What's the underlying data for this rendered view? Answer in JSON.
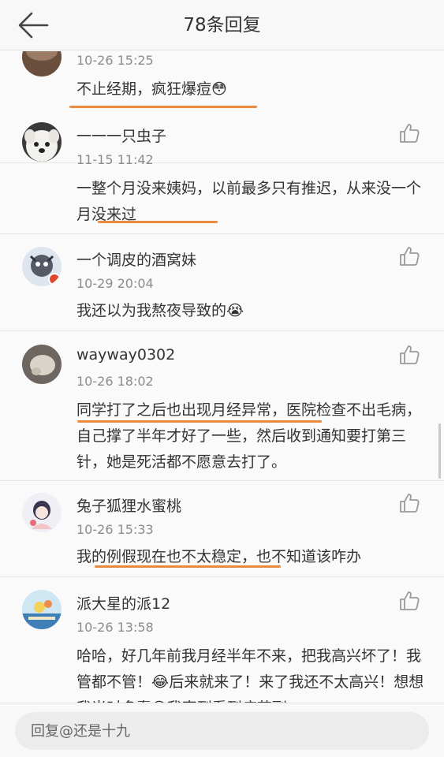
{
  "header": {
    "title": "78条回复"
  },
  "comments": [
    {
      "time": "10-26 15:25",
      "text": "不止经期，疯狂爆痘😳"
    },
    {
      "username": "一一一只虫子",
      "time": "11-15 11:42",
      "text": "一整个月没来姨妈，以前最多只有推迟，从来没一个月没来过"
    },
    {
      "username": "一个调皮的酒窝妹",
      "time": "10-29 20:04",
      "text": "我还以为我熬夜导致的😭"
    },
    {
      "username": "wayway0302",
      "time": "10-26 18:02",
      "text": "同学打了之后也出现月经异常，医院检查不出毛病，自己撑了半年才好了一些，然后收到通知要打第三针，她是死活都不愿意去打了。"
    },
    {
      "username": "兔子狐狸水蜜桃",
      "time": "10-26 15:33",
      "text": "我的例假现在也不太稳定，也不知道该咋办"
    },
    {
      "username": "派大星的派12",
      "time": "10-26 13:58",
      "text": "哈哈，好几年前我月经半年不来，把我高兴坏了！我管都不管！😂后来就来了！来了我还不太高兴！想想我当时多蠢😅我直到看到痘苗副"
    }
  ],
  "footer": {
    "reply_placeholder": "回复@还是十九"
  },
  "icons": {
    "back": "arrow-left-icon",
    "like": "thumbs-up-icon"
  },
  "colors": {
    "underline": "#e98a3e",
    "text": "#333333",
    "meta": "#8c8c8c"
  }
}
